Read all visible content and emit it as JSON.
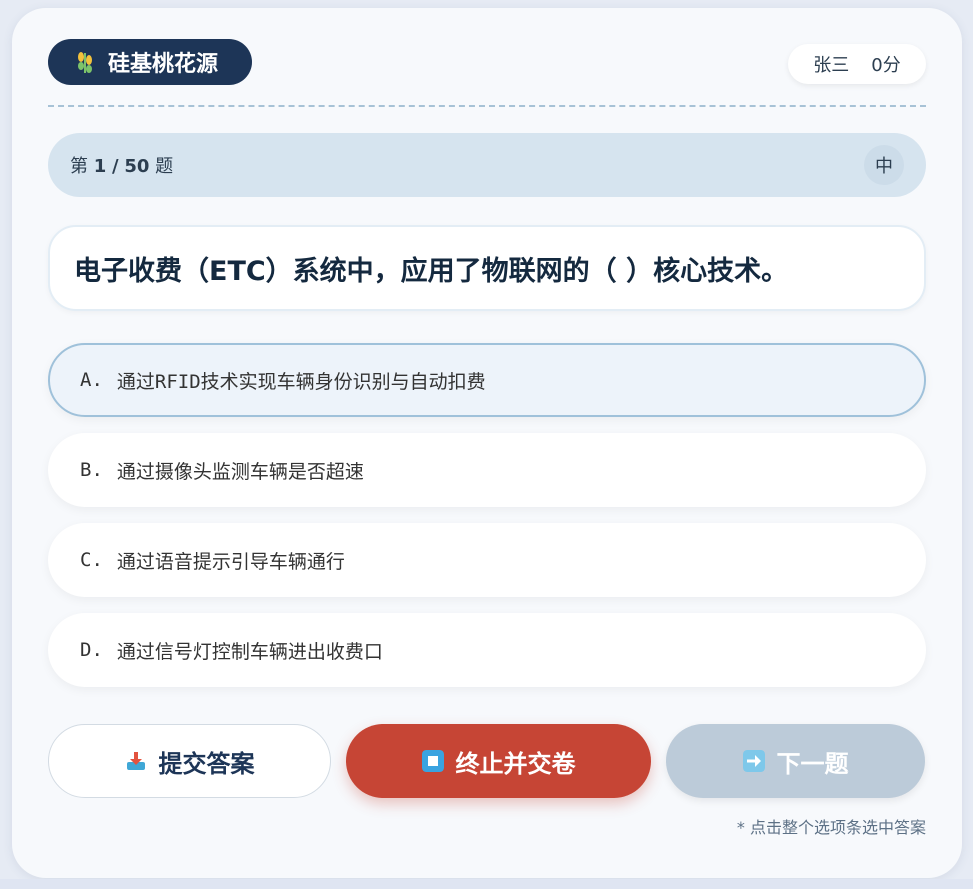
{
  "header": {
    "brand": "硅基桃花源",
    "user_name": "张三",
    "score": "0分"
  },
  "progress": {
    "prefix": "第",
    "current": "1",
    "separator": "/",
    "total": "50",
    "suffix": "题",
    "difficulty": "中"
  },
  "question": {
    "text": "电子收费（ETC）系统中，应用了物联网的（ ）核心技术。"
  },
  "options": [
    {
      "letter": "A.",
      "text": "通过RFID技术实现车辆身份识别与自动扣费",
      "selected": true
    },
    {
      "letter": "B.",
      "text": "通过摄像头监测车辆是否超速",
      "selected": false
    },
    {
      "letter": "C.",
      "text": "通过语音提示引导车辆通行",
      "selected": false
    },
    {
      "letter": "D.",
      "text": "通过信号灯控制车辆进出收费口",
      "selected": false
    }
  ],
  "buttons": {
    "submit": "提交答案",
    "stop": "终止并交卷",
    "next": "下一题"
  },
  "hint": "* 点击整个选项条选中答案",
  "colors": {
    "brand_bg": "#1d3557",
    "stop_bg": "#c64535",
    "next_bg": "#bccbd9",
    "selected_border": "#9fc1da"
  }
}
